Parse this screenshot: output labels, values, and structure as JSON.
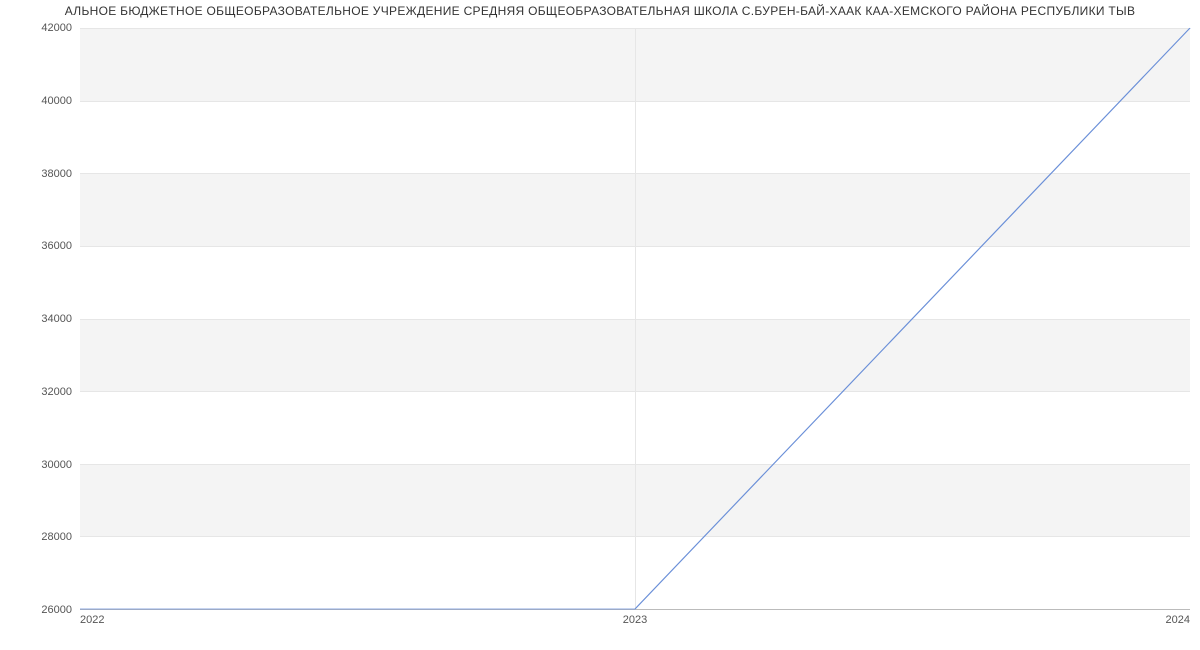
{
  "chart_data": {
    "type": "line",
    "title": "АЛЬНОЕ БЮДЖЕТНОЕ ОБЩЕОБРАЗОВАТЕЛЬНОЕ УЧРЕЖДЕНИЕ СРЕДНЯЯ ОБЩЕОБРАЗОВАТЕЛЬНАЯ ШКОЛА С.БУРЕН-БАЙ-ХААК КАА-ХЕМСКОГО РАЙОНА РЕСПУБЛИКИ ТЫВ",
    "x": [
      2022,
      2023,
      2024
    ],
    "values": [
      26000,
      26000,
      42000
    ],
    "xlabel": "",
    "ylabel": "",
    "xlim": [
      2022,
      2024
    ],
    "ylim": [
      26000,
      42000
    ],
    "yticks": [
      26000,
      28000,
      30000,
      32000,
      34000,
      36000,
      38000,
      40000,
      42000
    ],
    "xticks": [
      2022,
      2023,
      2024
    ]
  }
}
